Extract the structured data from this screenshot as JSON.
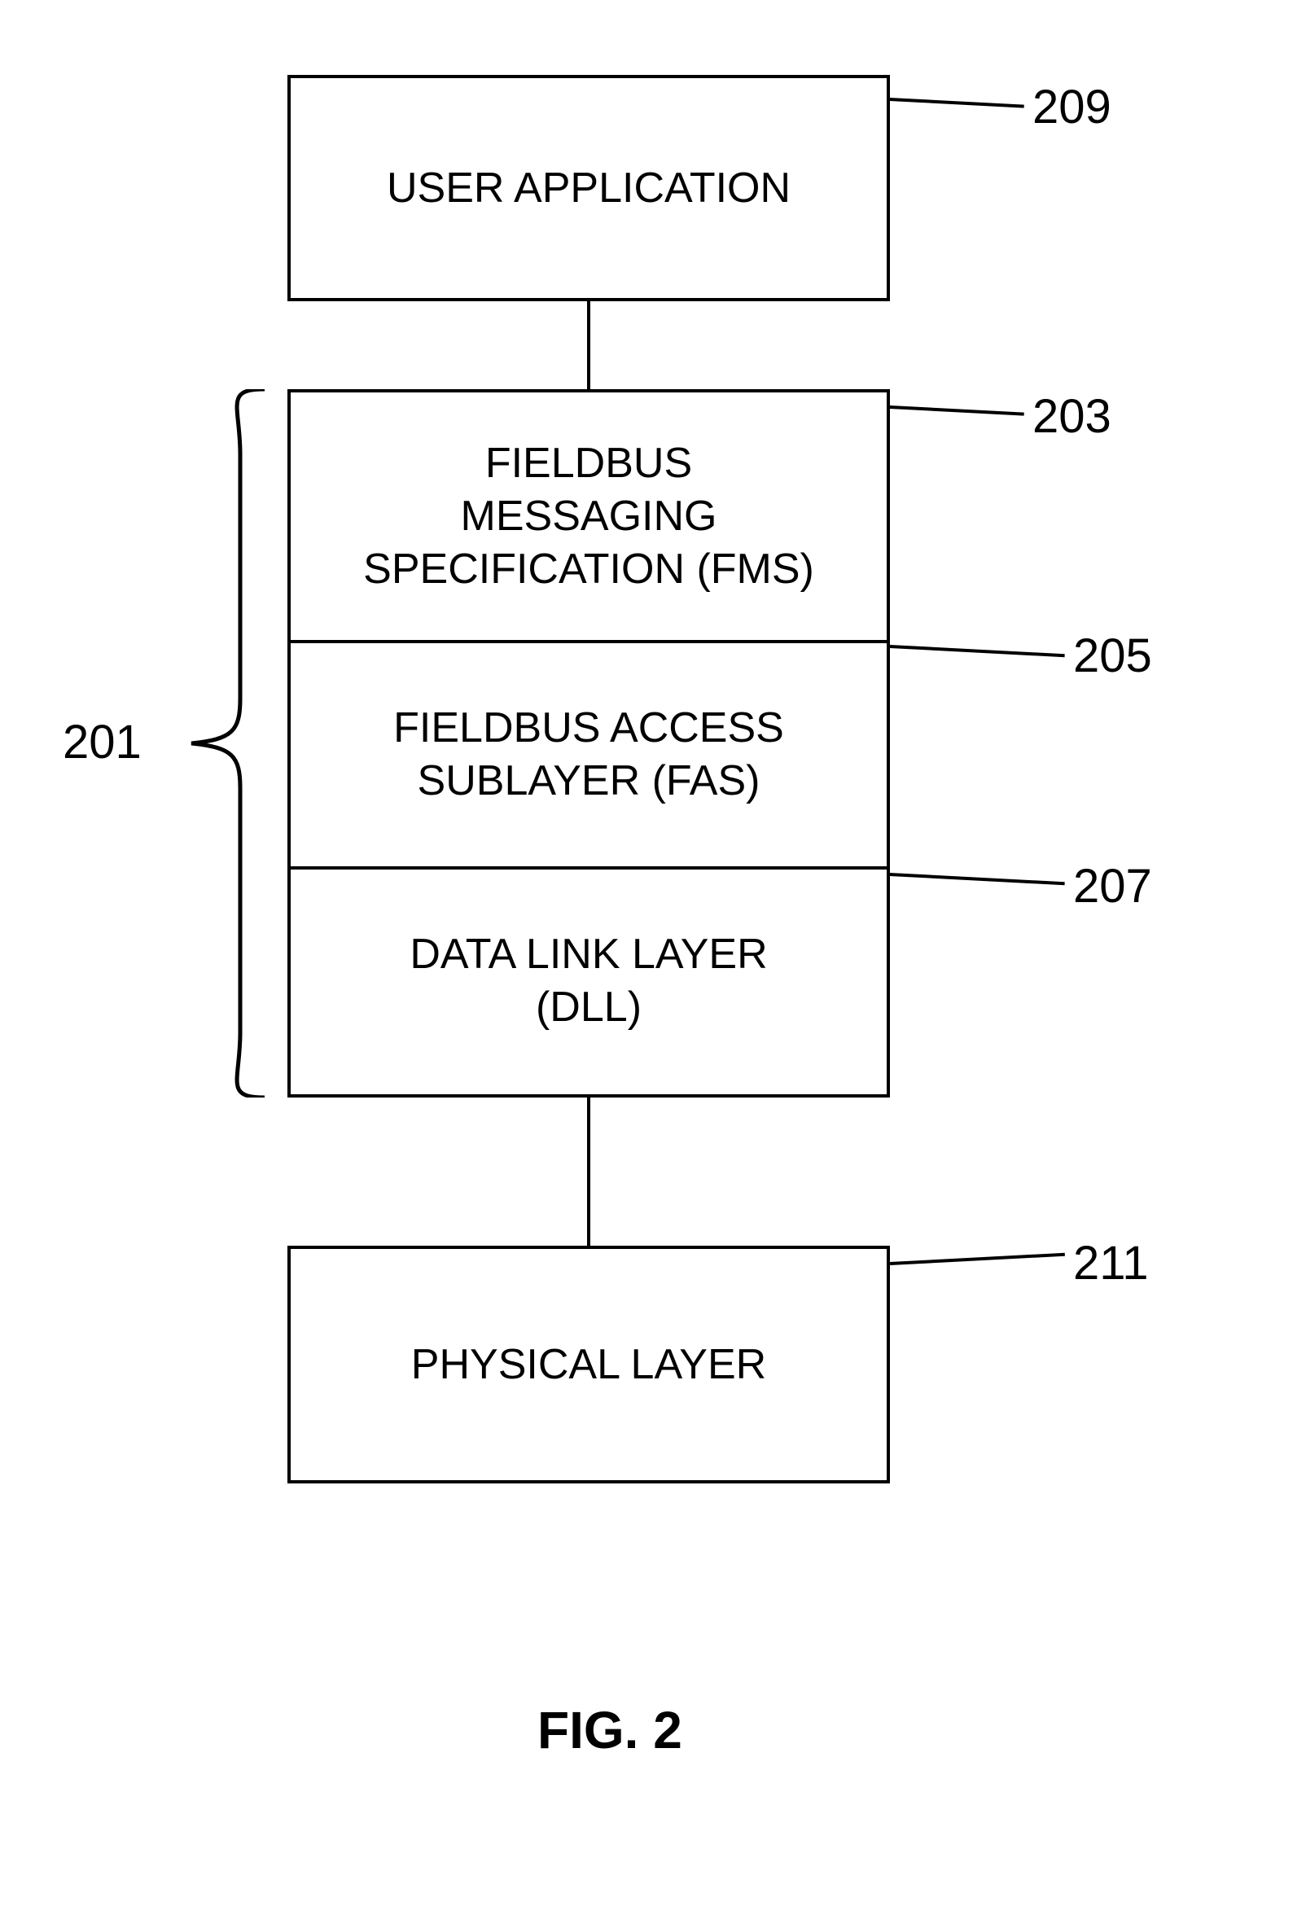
{
  "boxes": {
    "user_app": "USER APPLICATION",
    "fms_l1": "FIELDBUS",
    "fms_l2": "MESSAGING",
    "fms_l3": "SPECIFICATION (FMS)",
    "fas_l1": "FIELDBUS ACCESS",
    "fas_l2": "SUBLAYER (FAS)",
    "dll_l1": "DATA LINK LAYER",
    "dll_l2": "(DLL)",
    "phys": "PHYSICAL LAYER"
  },
  "labels": {
    "n209": "209",
    "n203": "203",
    "n205": "205",
    "n201": "201",
    "n207": "207",
    "n211": "211"
  },
  "caption": "FIG. 2"
}
